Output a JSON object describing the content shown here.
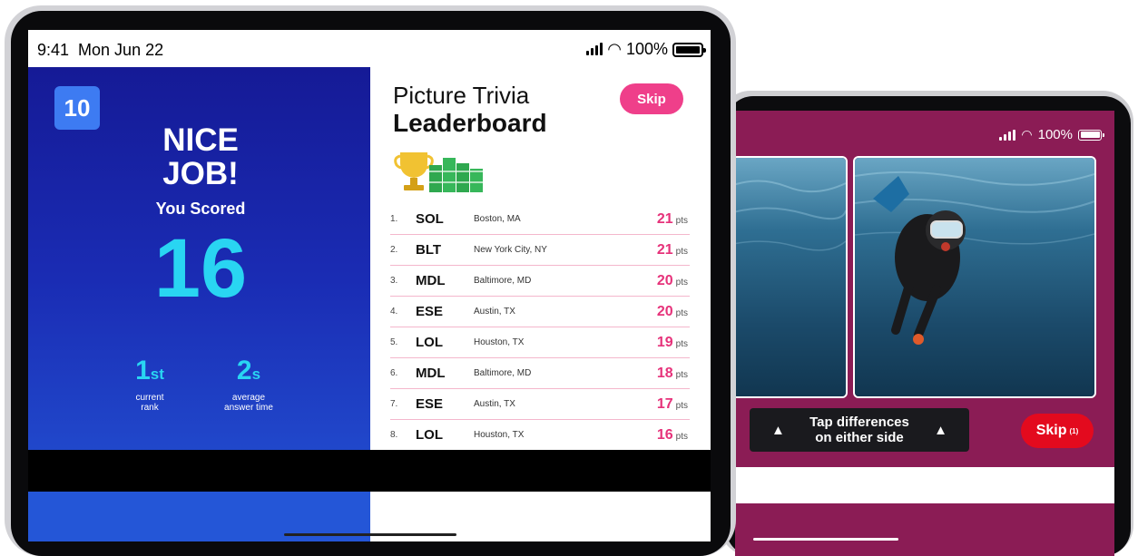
{
  "back_device": {
    "status": {
      "battery": "100%"
    },
    "hint": "Tap differences\non either side",
    "skip_label": "Skip",
    "skip_count": "(1)",
    "colors": {
      "background": "#8b1c55",
      "skip": "#e30a1e"
    }
  },
  "front_device": {
    "status": {
      "time": "9:41  Mon Jun 22",
      "battery": "100%"
    },
    "score": {
      "round": "10",
      "headline": "NICE\nJOB!",
      "subheading": "You Scored",
      "value": "16",
      "rank_value": "1",
      "rank_suffix": "st",
      "rank_label": "current\nrank",
      "time_value": "2",
      "time_suffix": "s",
      "time_label": "average\nanswer time"
    },
    "leaderboard": {
      "title_line1": "Picture Trivia",
      "title_line2": "Leaderboard",
      "skip_label": "Skip",
      "pts_unit": "pts",
      "rows": [
        {
          "rank": "1.",
          "code": "SOL",
          "city": "Boston, MA",
          "pts": "21"
        },
        {
          "rank": "2.",
          "code": "BLT",
          "city": "New York City, NY",
          "pts": "21"
        },
        {
          "rank": "3.",
          "code": "MDL",
          "city": "Baltimore, MD",
          "pts": "20"
        },
        {
          "rank": "4.",
          "code": "ESE",
          "city": "Austin, TX",
          "pts": "20"
        },
        {
          "rank": "5.",
          "code": "LOL",
          "city": "Houston, TX",
          "pts": "19"
        },
        {
          "rank": "6.",
          "code": "MDL",
          "city": "Baltimore, MD",
          "pts": "18"
        },
        {
          "rank": "7.",
          "code": "ESE",
          "city": "Austin, TX",
          "pts": "17"
        },
        {
          "rank": "8.",
          "code": "LOL",
          "city": "Houston, TX",
          "pts": "16"
        }
      ]
    },
    "colors": {
      "panel_top": "#151a96",
      "panel_bottom": "#2456d7",
      "accent": "#29d5f2",
      "pink": "#ef3f8a"
    }
  }
}
